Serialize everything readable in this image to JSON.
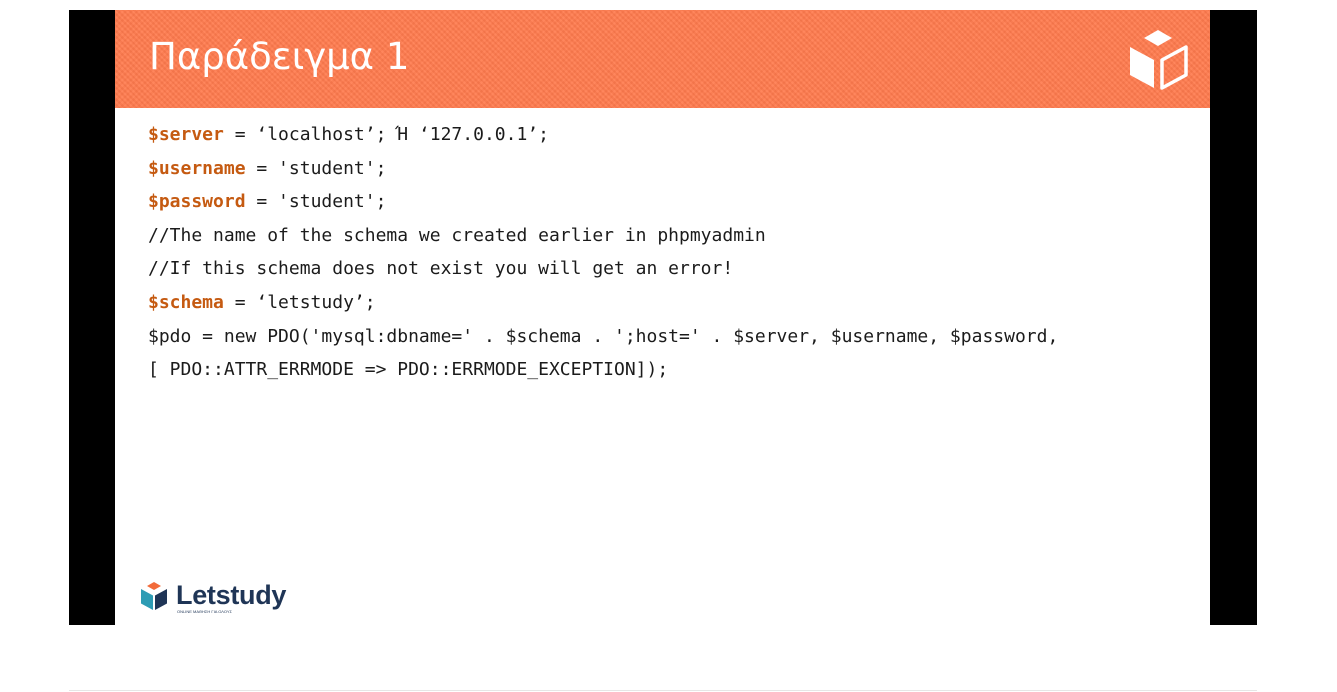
{
  "slide": {
    "title": "Παράδειγμα 1",
    "code_lines": [
      {
        "var": "$server",
        "rest": " = ‘localhost’; Ή ‘127.0.0.1’;"
      },
      {
        "var": "$username",
        "rest": " = 'student';"
      },
      {
        "var": "$password",
        "rest": " = 'student';"
      },
      {
        "var": "",
        "rest": "//The name of the schema we created earlier in phpmyadmin"
      },
      {
        "var": "",
        "rest": "//If this schema does not exist you will get an error!"
      },
      {
        "var": "$schema",
        "rest": " = ‘letstudy’;"
      },
      {
        "var": "",
        "rest": "$pdo = new PDO('mysql:dbname=' . $schema . ';host=' . $server, $username, $password,"
      },
      {
        "var": "",
        "rest": "[ PDO::ATTR_ERRMODE => PDO::ERRMODE_EXCEPTION]);"
      }
    ]
  },
  "brand": {
    "name": "Letstudy",
    "tagline": "ONLINE ΜΑΘΗΣΗ ΓΙΑ ΟΛΟΥΣ"
  },
  "icons": {
    "header_logo": "cube-logo-icon",
    "footer_logo": "letstudy-cube-icon"
  },
  "colors": {
    "header": "#ff7a4d",
    "variable_highlight": "#c55a11",
    "brand_navy": "#1f3556",
    "brand_teal": "#2d9cb4"
  }
}
